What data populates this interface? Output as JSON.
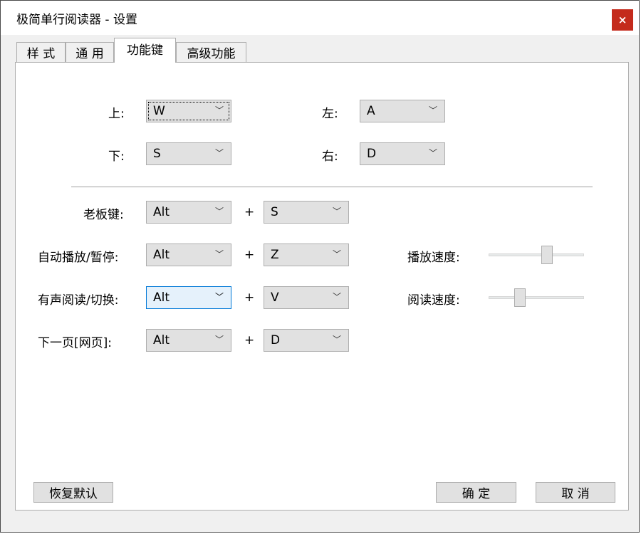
{
  "window": {
    "title": "极简单行阅读器 - 设置",
    "close_label": "×"
  },
  "tabs": [
    {
      "label": "样 式"
    },
    {
      "label": "通 用"
    },
    {
      "label": "功能键",
      "active": true
    },
    {
      "label": "高级功能"
    }
  ],
  "direction_keys": {
    "up": {
      "label": "上:",
      "value": "W"
    },
    "down": {
      "label": "下:",
      "value": "S"
    },
    "left": {
      "label": "左:",
      "value": "A"
    },
    "right": {
      "label": "右:",
      "value": "D"
    }
  },
  "hotkeys": [
    {
      "label": "老板键:",
      "modifier": "Alt",
      "key": "S"
    },
    {
      "label": "自动播放/暂停:",
      "modifier": "Alt",
      "key": "Z"
    },
    {
      "label": "有声阅读/切换:",
      "modifier": "Alt",
      "key": "V"
    },
    {
      "label": "下一页[网页]:",
      "modifier": "Alt",
      "key": "D"
    }
  ],
  "plus_sign": "+",
  "sliders": {
    "play_speed": {
      "label": "播放速度:",
      "level": 0.62
    },
    "read_speed": {
      "label": "阅读速度:",
      "level": 0.3
    }
  },
  "icons": {
    "dropdown": "chevron-down-icon",
    "close": "close-icon"
  },
  "buttons": {
    "restore_default": "恢复默认",
    "ok": "确 定",
    "cancel": "取 消"
  },
  "colors": {
    "close_bg": "#c42b1c",
    "panel_bg": "#ffffff",
    "client_bg": "#f0f0f0",
    "control_bg": "#e1e1e1",
    "hot_bg": "#e5f1fb",
    "hot_border": "#0078d7"
  }
}
